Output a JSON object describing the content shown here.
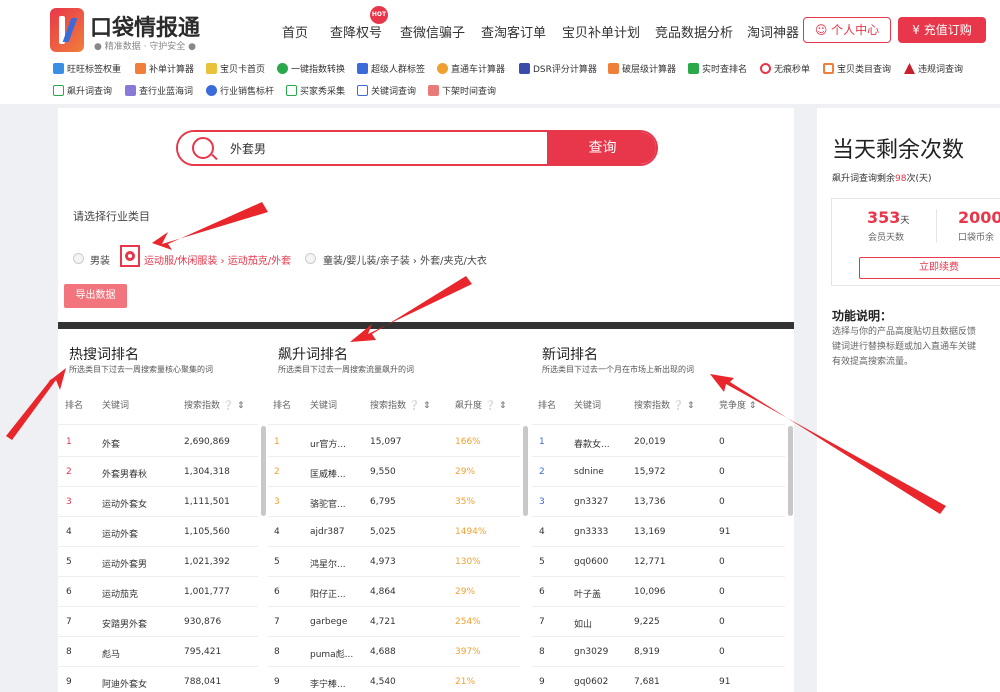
{
  "brand": {
    "title": "口袋情报通",
    "subtitle": "● 精准数据 · 守护安全 ●",
    "hot": "HOT"
  },
  "nav": {
    "items": [
      "首页",
      "查降权号",
      "查微信骗子",
      "查淘客订单",
      "宝贝补单计划",
      "竞品数据分析",
      "淘词神器"
    ],
    "user_center": "个人中心",
    "recharge": "充值订购"
  },
  "tools": {
    "row1": [
      "旺旺标签权重",
      "补单计算器",
      "宝贝卡首页",
      "一键指数转换",
      "超级人群标签",
      "直通车计算器",
      "DSR评分计算器",
      "破层级计算器",
      "实时查排名",
      "无痕秒单",
      "宝贝类目查询",
      "违规词查询"
    ],
    "row2": [
      "飙升词查询",
      "查行业蓝海词",
      "行业销售标杆",
      "买家秀采集",
      "关键词查询",
      "下架时间查询"
    ]
  },
  "search": {
    "value": "外套男",
    "button": "查询"
  },
  "category": {
    "label": "请选择行业类目",
    "options": [
      "男装",
      "运动服/休闲服装 › 运动茄克/外套",
      "童装/婴儿装/亲子装 › 外套/夹克/大衣"
    ]
  },
  "export": "导出数据",
  "hot_rank": {
    "title": "热搜词排名",
    "desc": "所选类目下过去一周搜索量核心聚集的词",
    "headers": [
      "排名",
      "关键词",
      "搜索指数"
    ],
    "rows": [
      [
        "1",
        "外套",
        "2,690,869"
      ],
      [
        "2",
        "外套男春秋",
        "1,304,318"
      ],
      [
        "3",
        "运动外套女",
        "1,111,501"
      ],
      [
        "4",
        "运动外套",
        "1,105,560"
      ],
      [
        "5",
        "运动外套男",
        "1,021,392"
      ],
      [
        "6",
        "运动茄克",
        "1,001,777"
      ],
      [
        "7",
        "安踏男外套",
        "930,876"
      ],
      [
        "8",
        "彪马",
        "795,421"
      ],
      [
        "9",
        "阿迪外套女",
        "788,041"
      ]
    ]
  },
  "rise_rank": {
    "title": "飙升词排名",
    "desc": "所选类目下过去一周搜索流量飙升的词",
    "headers": [
      "排名",
      "关键词",
      "搜索指数",
      "飙升度"
    ],
    "rows": [
      [
        "1",
        "ur官方...",
        "15,097",
        "166%"
      ],
      [
        "2",
        "匡威棒...",
        "9,550",
        "29%"
      ],
      [
        "3",
        "骆驼官...",
        "6,795",
        "35%"
      ],
      [
        "4",
        "ajdr387",
        "5,025",
        "1494%"
      ],
      [
        "5",
        "鸿星尔...",
        "4,973",
        "130%"
      ],
      [
        "6",
        "阳仔正...",
        "4,864",
        "29%"
      ],
      [
        "7",
        "garbege",
        "4,721",
        "254%"
      ],
      [
        "8",
        "puma彪...",
        "4,688",
        "397%"
      ],
      [
        "9",
        "李宁棒...",
        "4,540",
        "21%"
      ]
    ]
  },
  "new_rank": {
    "title": "新词排名",
    "desc": "所选类目下过去一个月在市场上新出现的词",
    "headers": [
      "排名",
      "关键词",
      "搜索指数",
      "竞争度"
    ],
    "rows": [
      [
        "1",
        "春款女...",
        "20,019",
        "0"
      ],
      [
        "2",
        "sdnine",
        "15,972",
        "0"
      ],
      [
        "3",
        "gn3327",
        "13,736",
        "0"
      ],
      [
        "4",
        "gn3333",
        "13,169",
        "91"
      ],
      [
        "5",
        "gq0600",
        "12,771",
        "0"
      ],
      [
        "6",
        "叶子盖",
        "10,096",
        "0"
      ],
      [
        "7",
        "如山",
        "9,225",
        "0"
      ],
      [
        "8",
        "gn3029",
        "8,919",
        "0"
      ],
      [
        "9",
        "gq0602",
        "7,681",
        "91"
      ]
    ]
  },
  "side": {
    "title": "当天剩余次数",
    "sub_prefix": "飙升词查询剩余",
    "sub_count": "98",
    "sub_suffix": "次(天)",
    "member_days": "353",
    "member_unit": "天",
    "member_label": "会员天数",
    "coins": "2000+",
    "coins_label": "口袋币余",
    "renew": "立即续费",
    "func_title": "功能说明：",
    "func_lines": [
      "选择与你的产品高度贴切且数据反馈",
      "键词进行替换标题或加入直通车关键",
      "有效提高搜索流量。"
    ]
  },
  "colors": {
    "accent": "#e8364b",
    "rise": "#f0a030",
    "rank_top": "#e8364b",
    "new_top": "#3a6bd8"
  }
}
